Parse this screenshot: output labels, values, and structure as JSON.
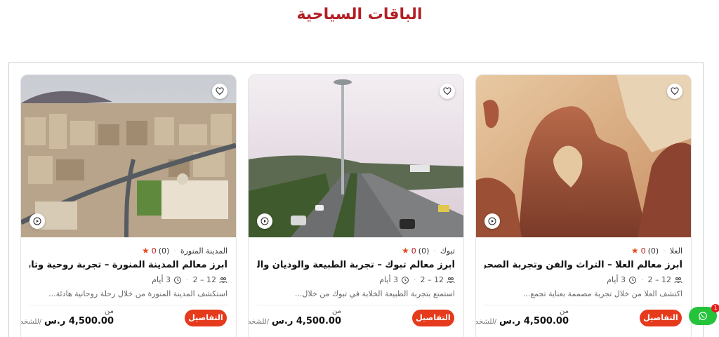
{
  "page": {
    "title": "الباقات السياحية"
  },
  "cards": [
    {
      "location": "العلا",
      "rating_count": "(0)",
      "rating_value": "0",
      "title": "أبرز معالم العلا – التراث والفن وتجربة الصحراء",
      "group_size": "12 – 2",
      "duration": "3 أيام",
      "description": "اكتشف العلا من خلال تجربة مصممة بعناية تجمع...",
      "price_from": "من",
      "price_amount": "4,500.00 ر.س",
      "price_per": "/للشخص",
      "details_label": "التفاصيل"
    },
    {
      "location": "تبوك",
      "rating_count": "(0)",
      "rating_value": "0",
      "title": "أبرز معالم تبوك – تجربة الطبيعة والوديان والصحراء",
      "group_size": "12 – 2",
      "duration": "3 أيام",
      "description": "استمتع بتجربة الطبيعة الخلابة في تبوك من خلال...",
      "price_from": "من",
      "price_amount": "4,500.00 ر.س",
      "price_per": "/للشخص",
      "details_label": "التفاصيل"
    },
    {
      "location": "المدينة المنورة",
      "rating_count": "(0)",
      "rating_value": "0",
      "title": "أبرز معالم المدينة المنورة – تجربة روحية وتاريخية",
      "group_size": "12 – 2",
      "duration": "3 أيام",
      "description": "استكشف المدينة المنورة من خلال رحلة روحانية هادئة...",
      "price_from": "من",
      "price_amount": "4,500.00 ر.س",
      "price_per": "/للشخص",
      "details_label": "التفاصيل"
    }
  ],
  "whatsapp": {
    "badge": "1"
  },
  "colors": {
    "title": "#b21f24",
    "button": "#e63a1d",
    "whatsapp": "#25c33c",
    "star": "#e0501f"
  },
  "icons": [
    "heart-icon",
    "play-icon",
    "star-icon",
    "users-icon",
    "clock-icon",
    "whatsapp-icon"
  ]
}
